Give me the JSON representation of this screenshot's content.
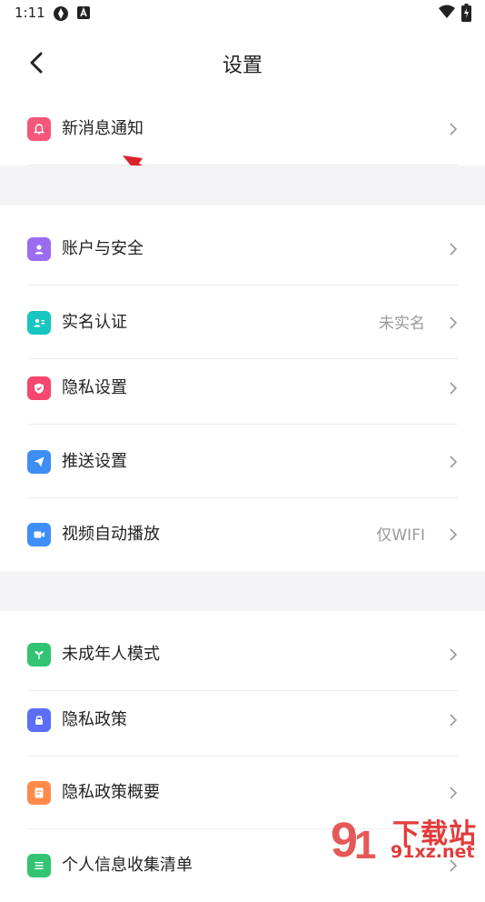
{
  "status_bar": {
    "time": "1:11"
  },
  "header": {
    "title": "设置"
  },
  "groups": [
    {
      "items": [
        {
          "label": "新消息通知",
          "value": "",
          "icon": "bell-icon",
          "color": "#f5577a"
        }
      ]
    },
    {
      "items": [
        {
          "label": "账户与安全",
          "value": "",
          "icon": "user-icon",
          "color": "#9b6bf0"
        },
        {
          "label": "实名认证",
          "value": "未实名",
          "icon": "id-card-icon",
          "color": "#17c6c0"
        },
        {
          "label": "隐私设置",
          "value": "",
          "icon": "shield-icon",
          "color": "#f5476f"
        },
        {
          "label": "推送设置",
          "value": "",
          "icon": "send-icon",
          "color": "#3e8df2"
        },
        {
          "label": "视频自动播放",
          "value": "仅WIFI",
          "icon": "video-icon",
          "color": "#3f8ef7"
        }
      ]
    },
    {
      "items": [
        {
          "label": "未成年人模式",
          "value": "",
          "icon": "sprout-icon",
          "color": "#33c473"
        },
        {
          "label": "隐私政策",
          "value": "",
          "icon": "lock-icon",
          "color": "#5b6ef5"
        },
        {
          "label": "隐私政策概要",
          "value": "",
          "icon": "document-icon",
          "color": "#ff8a4c"
        },
        {
          "label": "个人信息收集清单",
          "value": "",
          "icon": "list-icon",
          "color": "#33c473"
        }
      ]
    }
  ],
  "watermark": {
    "text": "下载站",
    "url": "91xz.net"
  }
}
